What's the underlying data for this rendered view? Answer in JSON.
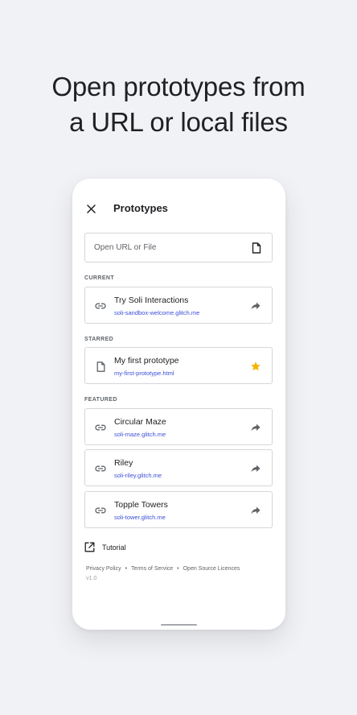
{
  "headline": {
    "line1": "Open prototypes from",
    "line2": "a URL or local files"
  },
  "app": {
    "title": "Prototypes",
    "close_icon": "close-icon"
  },
  "search": {
    "placeholder": "Open URL or File",
    "value": "",
    "icon": "file-icon"
  },
  "sections": {
    "current": {
      "label": "CURRENT",
      "items": [
        {
          "title": "Try Soli Interactions",
          "url": "soli-sandbox-welcome.glitch.me",
          "lead_icon": "link-icon",
          "trail_icon": "share-icon"
        }
      ]
    },
    "starred": {
      "label": "STARRED",
      "items": [
        {
          "title": "My first prototype",
          "url": "my-first-prototype.html",
          "lead_icon": "file-icon",
          "trail_icon": "star-icon"
        }
      ]
    },
    "featured": {
      "label": "FEATURED",
      "items": [
        {
          "title": "Circular Maze",
          "url": "soli-maze.glitch.me",
          "lead_icon": "link-icon",
          "trail_icon": "share-icon"
        },
        {
          "title": "Riley",
          "url": "soli-riley.glitch.me",
          "lead_icon": "link-icon",
          "trail_icon": "share-icon"
        },
        {
          "title": "Topple Towers",
          "url": "soli-tower.glitch.me",
          "lead_icon": "link-icon",
          "trail_icon": "share-icon"
        }
      ]
    }
  },
  "tutorial": {
    "label": "Tutorial",
    "icon": "open-in-new-icon"
  },
  "footer": {
    "privacy": "Privacy Policy",
    "separator": "•",
    "terms": "Terms of Service",
    "licences": "Open Source Licences",
    "version": "v1.0"
  },
  "colors": {
    "background": "#f1f2f5",
    "card": "#ffffff",
    "link": "#3c4fd6",
    "star": "#f4b400",
    "border": "#d4d6da"
  }
}
